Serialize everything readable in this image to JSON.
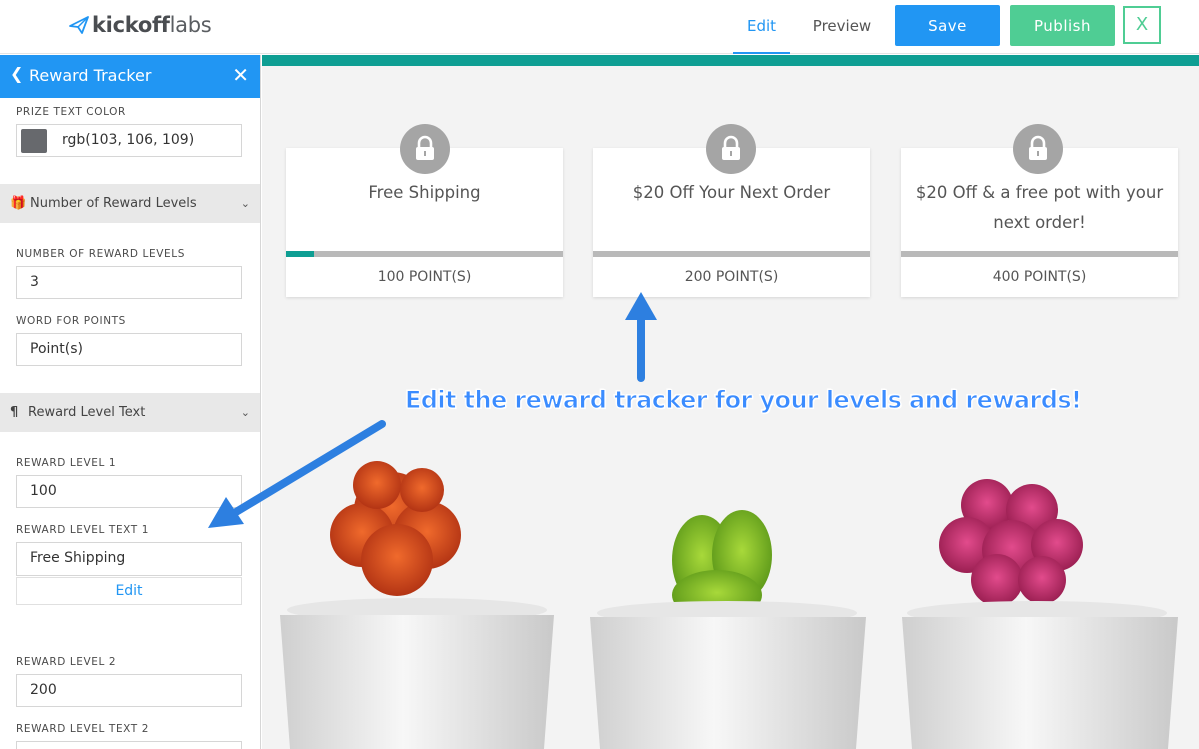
{
  "header": {
    "logo_bold": "kickoff",
    "logo_light": "labs",
    "nav_edit": "Edit",
    "nav_preview": "Preview",
    "save_label": "Save",
    "publish_label": "Publish",
    "close_label": "X",
    "accent_color": "#2196f3",
    "publish_color": "#4fcd94"
  },
  "sidebar": {
    "title": "Reward Tracker",
    "prize_text_color_label": "PRIZE TEXT COLOR",
    "prize_text_color_value": "rgb(103, 106, 109)",
    "section_levels": "Number of Reward Levels",
    "num_levels_label": "NUMBER OF REWARD LEVELS",
    "num_levels_value": "3",
    "word_points_label": "WORD FOR POINTS",
    "word_points_value": "Point(s)",
    "section_text": "Reward Level Text",
    "level1_label": "REWARD LEVEL 1",
    "level1_value": "100",
    "level1_text_label": "REWARD LEVEL TEXT 1",
    "level1_text_value": "Free Shipping",
    "edit_label": "Edit",
    "level2_label": "REWARD LEVEL 2",
    "level2_value": "200",
    "level2_text_label": "REWARD LEVEL TEXT 2"
  },
  "rewards": [
    {
      "title": "Free Shipping",
      "points": "100 POINT(S)",
      "progress": 0.1
    },
    {
      "title": "$20 Off Your Next Order",
      "points": "200 POINT(S)",
      "progress": 0
    },
    {
      "title": "$20 Off & a free pot with your next order!",
      "points": "400 POINT(S)",
      "progress": 0
    }
  ],
  "annotation": "Edit the reward tracker for your levels and rewards!",
  "theme": {
    "teal": "#0e9e93"
  }
}
